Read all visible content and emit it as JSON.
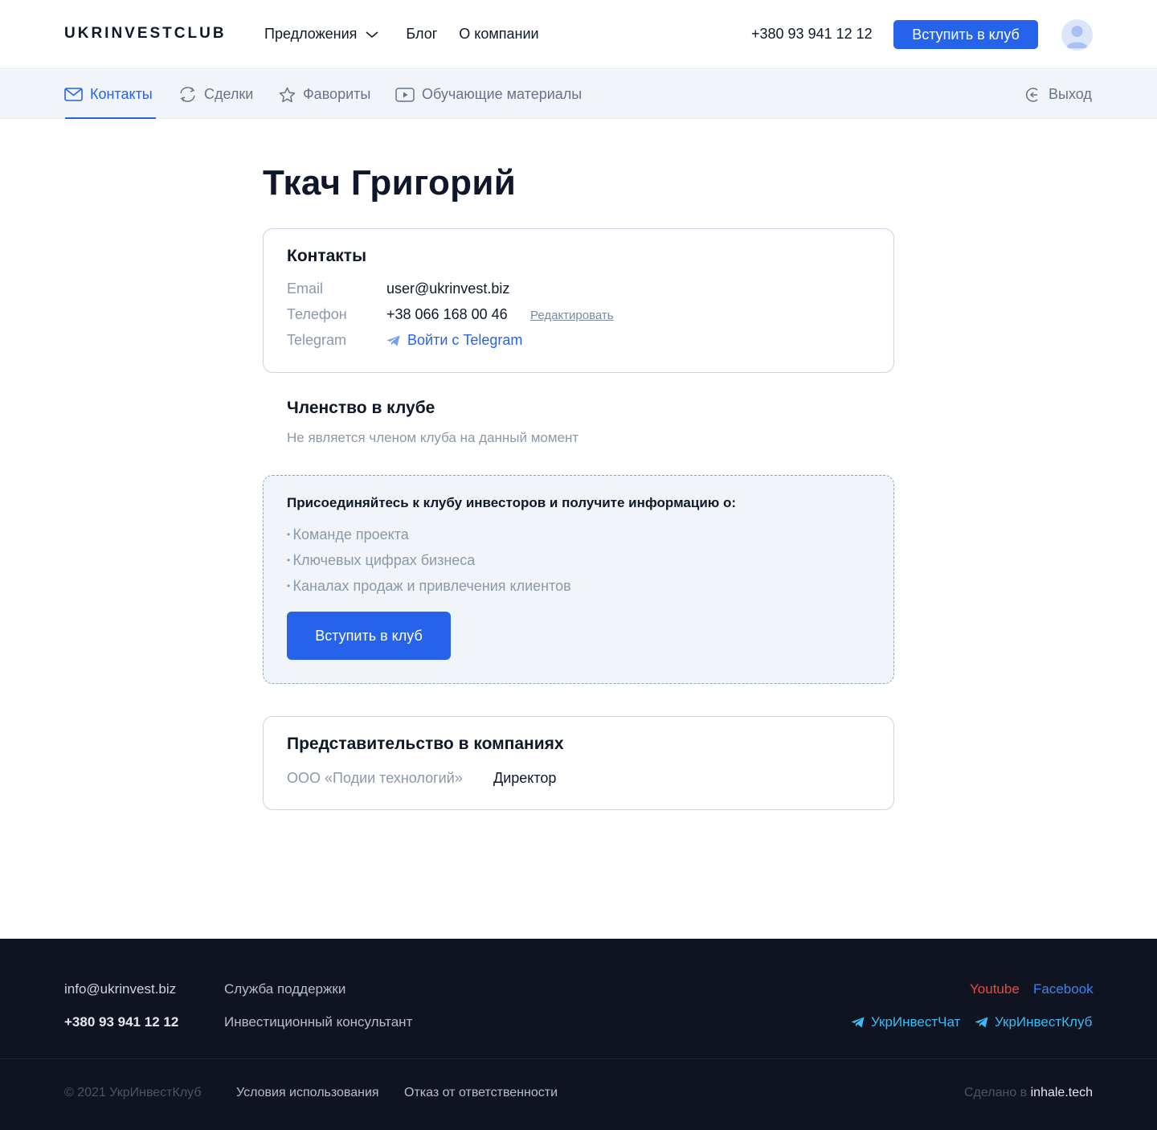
{
  "header": {
    "logo": "UKRINVESTCLUB",
    "nav": [
      "Предложения",
      "Блог",
      "О компании"
    ],
    "phone": "+380 93 941 12 12",
    "join_label": "Вступить в клуб",
    "avatar_icon": "user-avatar-icon"
  },
  "tabs": [
    {
      "label": "Контакты",
      "icon": "envelope-icon",
      "active": true
    },
    {
      "label": "Сделки",
      "icon": "refresh-icon",
      "active": false
    },
    {
      "label": "Фавориты",
      "icon": "star-icon",
      "active": false
    },
    {
      "label": "Обучающие материалы",
      "icon": "play-video-icon",
      "active": false
    }
  ],
  "logout_label": "Выход",
  "profile": {
    "name": "Ткач Григорий"
  },
  "contacts": {
    "title": "Контакты",
    "email_label": "Email",
    "email_value": "user@ukrinvest.biz",
    "phone_label": "Телефон",
    "phone_value": "+38 066 168 00 46",
    "edit_label": "Редактировать",
    "telegram_label": "Telegram",
    "telegram_link": "Войти с Telegram"
  },
  "membership": {
    "title": "Членство в клубе",
    "status": "Не является членом клуба на данный момент"
  },
  "promo": {
    "heading": "Присоединяйтесь к клубу инвесторов и получите информацию о:",
    "items": [
      "Команде проекта",
      "Ключевых цифрах бизнеса",
      "Каналах продаж и привлечения клиентов"
    ],
    "button": "Вступить в клуб"
  },
  "companies": {
    "title": "Представительство в компаниях",
    "name": "ООО «Подии технологий»",
    "role": "Директор"
  },
  "footer": {
    "email": "info@ukrinvest.biz",
    "phone": "+380 93 941 12 12",
    "support": "Служба поддержки",
    "consultant": "Инвестиционный консультант",
    "youtube": "Youtube",
    "facebook": "Facebook",
    "tg_chat": "УкрИнвестЧат",
    "tg_club": "УкрИнвестКлуб",
    "copyright": "© 2021 УкрИнвестКлуб",
    "terms": "Условия использования",
    "disclaimer": "Отказ от ответственности",
    "made_prefix": "Сделано в",
    "made_brand": "inhale.tech"
  },
  "colors": {
    "accent": "#2563eb",
    "footer_bg": "#0f1420",
    "youtube": "#ef4444",
    "telegram": "#38bdf8"
  }
}
